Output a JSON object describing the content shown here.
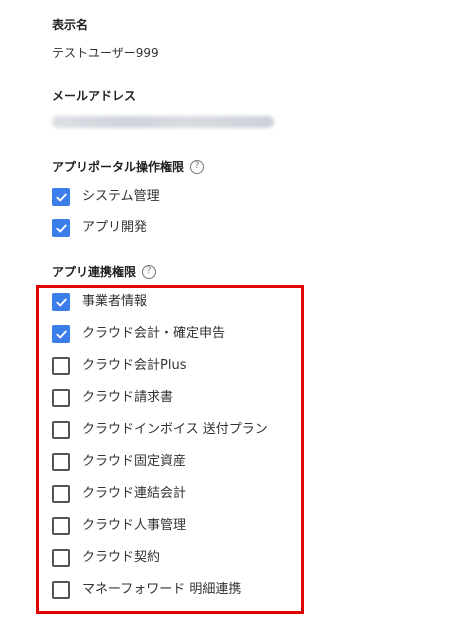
{
  "display_name": {
    "label": "表示名",
    "value": "テストユーザー999"
  },
  "email": {
    "label": "メールアドレス"
  },
  "portal_permissions": {
    "label": "アプリポータル操作権限",
    "help_glyph": "?",
    "items": [
      {
        "label": "システム管理",
        "checked": true
      },
      {
        "label": "アプリ開発",
        "checked": true
      }
    ]
  },
  "app_permissions": {
    "label": "アプリ連携権限",
    "help_glyph": "?",
    "highlight_color": "#e00000",
    "items": [
      {
        "label": "事業者情報",
        "checked": true
      },
      {
        "label": "クラウド会計・確定申告",
        "checked": true
      },
      {
        "label": "クラウド会計Plus",
        "checked": false
      },
      {
        "label": "クラウド請求書",
        "checked": false
      },
      {
        "label": "クラウドインボイス 送付プラン",
        "checked": false
      },
      {
        "label": "クラウド固定資産",
        "checked": false
      },
      {
        "label": "クラウド連結会計",
        "checked": false
      },
      {
        "label": "クラウド人事管理",
        "checked": false
      },
      {
        "label": "クラウド契約",
        "checked": false
      },
      {
        "label": "マネーフォワード 明細連携",
        "checked": false
      }
    ]
  },
  "colors": {
    "checkbox_checked": "#3b7de9",
    "checkbox_unchecked_border": "#555555",
    "text": "#333333"
  }
}
